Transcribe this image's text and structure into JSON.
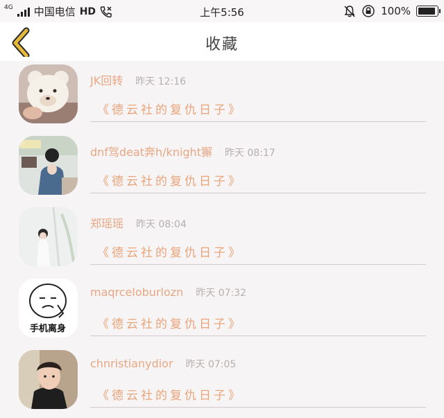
{
  "status_bar": {
    "network": "4G",
    "carrier": "中国电信",
    "hd": "HD",
    "time": "上午5:56",
    "battery": "100%",
    "battery_level": 1.0
  },
  "nav": {
    "title": "收藏",
    "back_icon": "chevron-left-icon",
    "accent_color": "#e5b93b"
  },
  "favorites": [
    {
      "name": "JK回转",
      "time": "昨天 12:16",
      "title": "《德云社的复仇日子》"
    },
    {
      "name": "dnf驾deat奔h/knight獬",
      "time": "昨天 08:17",
      "title": "《德云社的复仇日子》"
    },
    {
      "name": "郑瑶瑶",
      "time": "昨天 08:04",
      "title": "《德云社的复仇日子》"
    },
    {
      "name": "maqrceloburlozn",
      "time": "昨天 07:32",
      "title": "《德云社的复仇日子》"
    },
    {
      "name": "chnristianydior",
      "time": "昨天 07:05",
      "title": "《德云社的复仇日子》"
    }
  ],
  "avatar4_caption": "手机离身"
}
